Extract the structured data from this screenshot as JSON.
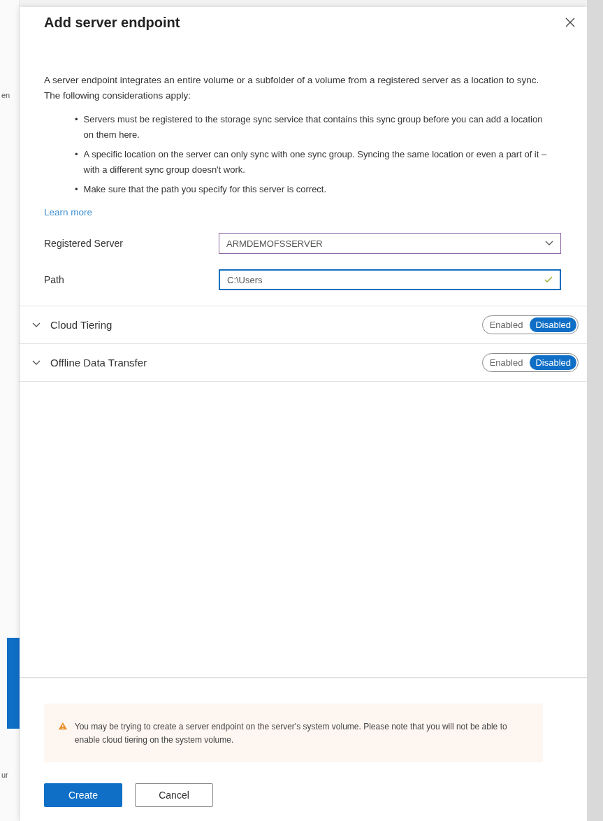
{
  "backdrop": {
    "fragments": [
      {
        "text": "en"
      },
      {
        "text": "ur"
      }
    ]
  },
  "panel": {
    "title": "Add server endpoint",
    "intro": "A server endpoint integrates an entire volume or a subfolder of a volume from a registered server as a location to sync. The following considerations apply:",
    "bullet_marker": "•",
    "bullets": [
      "Servers must be registered to the storage sync service that contains this sync group before you can add a location on them here.",
      "A specific location on the server can only sync with one sync group. Syncing the same location or even a part of it – with a different sync group doesn't work.",
      "Make sure that the path you specify for this server is correct."
    ],
    "learn_more": "Learn more",
    "fields": [
      {
        "label": "Registered Server",
        "kind": "dropdown",
        "value": "ARMDEMOFSSERVER",
        "focused": false,
        "valid": false
      },
      {
        "label": "Path",
        "kind": "text",
        "value": "C:\\Users",
        "focused": true,
        "valid": true
      }
    ],
    "sections": [
      {
        "title": "Cloud Tiering",
        "expanded": false,
        "options": [
          {
            "label": "Enabled",
            "selected": false
          },
          {
            "label": "Disabled",
            "selected": true
          }
        ]
      },
      {
        "title": "Offline Data Transfer",
        "expanded": false,
        "options": [
          {
            "label": "Enabled",
            "selected": false
          },
          {
            "label": "Disabled",
            "selected": true
          }
        ]
      }
    ],
    "warning": "You may be trying to create a server endpoint on the server's system volume. Please note that you will not be able to enable cloud tiering on the system volume.",
    "buttons": [
      {
        "label": "Create",
        "kind": "primary"
      },
      {
        "label": "Cancel",
        "kind": "secondary"
      }
    ]
  }
}
